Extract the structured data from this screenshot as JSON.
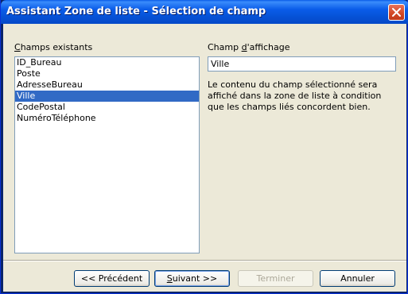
{
  "window": {
    "title": "Assistant Zone de liste - Sélection de champ"
  },
  "fields": {
    "label_accesskey": "C",
    "label_rest": "hamps existants",
    "items": [
      "ID_Bureau",
      "Poste",
      "AdresseBureau",
      "Ville",
      "CodePostal",
      "NuméroTéléphone"
    ],
    "selected": "Ville"
  },
  "display_field": {
    "label_prefix": "Champ ",
    "label_accesskey": "d",
    "label_rest": "'affichage",
    "value": "Ville"
  },
  "description": "Le contenu du champ sélectionné sera affiché dans la zone de liste à condition que les champs liés concordent bien.",
  "buttons": {
    "previous": "<< Précédent",
    "next_accesskey": "S",
    "next_rest": "uivant >>",
    "finish": "Terminer",
    "cancel": "Annuler"
  },
  "colors": {
    "selection": "#316ac5",
    "titlebar": "#0a5ce8",
    "close": "#d14623"
  },
  "icons": {
    "close": "close-icon"
  }
}
